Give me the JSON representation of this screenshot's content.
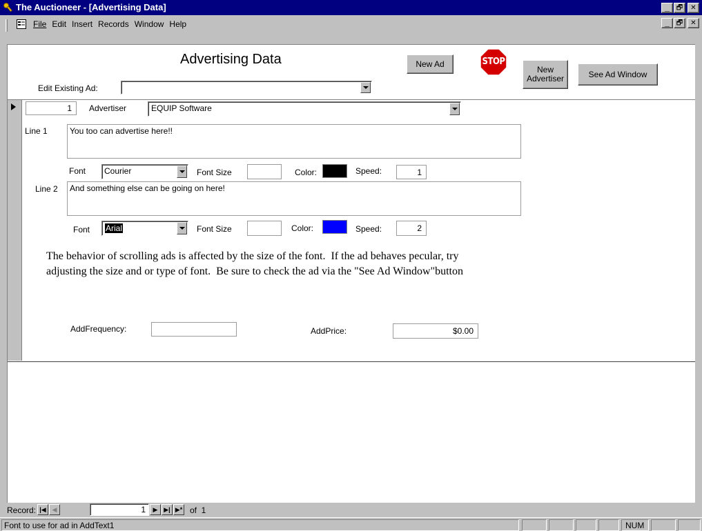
{
  "window": {
    "title": "The Auctioneer - [Advertising Data]",
    "min_glyph": "_",
    "max_glyph": "🗗",
    "close_glyph": "✕"
  },
  "menu": {
    "items": [
      {
        "label": "File"
      },
      {
        "label": "Edit"
      },
      {
        "label": "Insert"
      },
      {
        "label": "Records"
      },
      {
        "label": "Window"
      },
      {
        "label": "Help"
      }
    ]
  },
  "form": {
    "heading": "Advertising Data",
    "new_ad_label": "New Ad",
    "stop_label": "STOP",
    "new_advertiser_label": "New Advertiser",
    "see_ad_window_label": "See Ad Window",
    "edit_existing_label": "Edit Existing Ad:",
    "edit_existing_value": "",
    "record_id": "1",
    "advertiser_label": "Advertiser",
    "advertiser_value": "EQUIP Software",
    "line1": {
      "label": "Line 1",
      "text": "You too can advertise here!!",
      "font_label": "Font",
      "font_value": "Courier",
      "font_size_label": "Font Size",
      "font_size_value": "",
      "color_label": "Color:",
      "color": "#000000",
      "speed_label": "Speed:",
      "speed_value": "1"
    },
    "line2": {
      "label": "Line 2",
      "text": "And something else can be going on here!",
      "font_label": "Font",
      "font_value": "Arial",
      "font_size_label": "Font Size",
      "font_size_value": "",
      "color_label": "Color:",
      "color": "#0000ff",
      "speed_label": "Speed:",
      "speed_value": "2"
    },
    "note_line1": "The behavior of scrolling ads is affected by the size of the font.  If the ad behaves pecular, try",
    "note_line2": "adjusting the size and or type of font.  Be sure to check the ad via the \"See Ad Window\"button",
    "add_frequency_label": "AddFrequency:",
    "add_frequency_value": "",
    "add_price_label": "AddPrice:",
    "add_price_value": "$0.00"
  },
  "record_nav": {
    "label": "Record:",
    "current": "1",
    "of_text": "of  1"
  },
  "status": {
    "text": "Font to use for ad in AddText1",
    "num": "NUM"
  },
  "colors": {
    "titlebar": "#000080",
    "stop": "#d40000"
  }
}
